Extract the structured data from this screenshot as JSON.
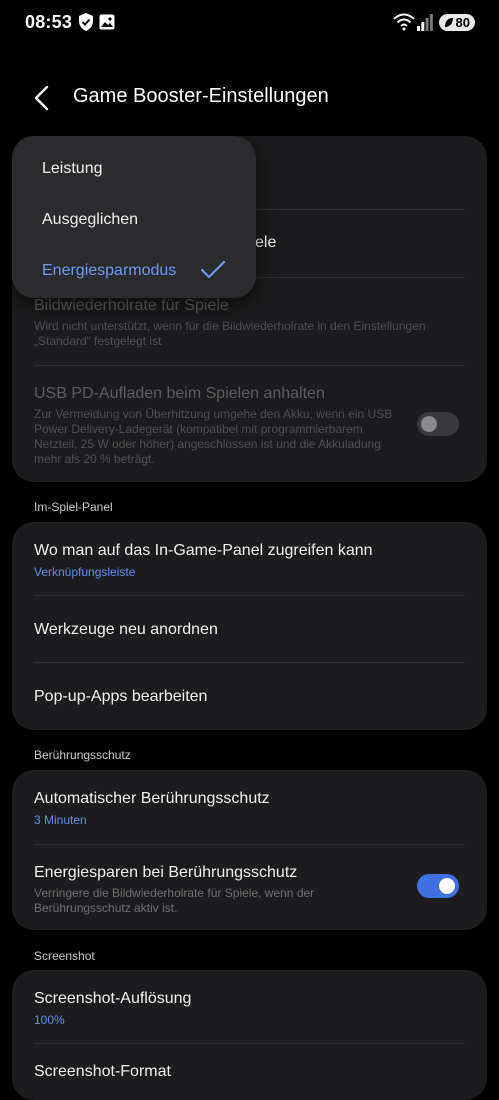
{
  "status_bar": {
    "time": "08:53",
    "battery": "80",
    "icons": [
      "shield-check-icon",
      "image-icon",
      "wifi-icon",
      "signal-icon",
      "battery-icon"
    ]
  },
  "header": {
    "title": "Game Booster-Einstellungen",
    "back_icon": "chevron-left-icon"
  },
  "performance_card": {
    "row2_fragment": "ele",
    "refresh": {
      "title": "Bildwiederholrate für Spiele",
      "desc": "Wird nicht unterstützt, wenn für die Bildwiederholrate in den Einstellungen „Standard“ festgelegt ist"
    },
    "usb_pd": {
      "title": "USB PD-Aufladen beim Spielen anhalten",
      "desc": "Zur Vermeidung von Überhitzung umgehe den Akku, wenn ein USB Power Delivery-Ladegerät (kompatibel mit programmierbarem Netzteil, 25 W oder höher) angeschlossen ist und die Akkuladung mehr als 20 % beträgt.",
      "enabled": false
    }
  },
  "dropdown": {
    "options": [
      "Leistung",
      "Ausgeglichen",
      "Energiesparmodus"
    ],
    "selected": "Energiesparmodus"
  },
  "panel_section": {
    "label": "Im-Spiel-Panel",
    "access": {
      "title": "Wo man auf das In-Game-Panel zugreifen kann",
      "value": "Verknüpfungsleiste"
    },
    "rearrange": "Werkzeuge neu anordnen",
    "popup_apps": "Pop-up-Apps bearbeiten"
  },
  "touch_section": {
    "label": "Berührungsschutz",
    "auto": {
      "title": "Automatischer Berührungsschutz",
      "value": "3 Minuten"
    },
    "power_save": {
      "title": "Energiesparen bei Berührungsschutz",
      "desc": "Verringere die Bildwiederholrate für Spiele, wenn der Berührungsschutz aktiv ist.",
      "enabled": true
    }
  },
  "screenshot_section": {
    "label": "Screenshot",
    "resolution": {
      "title": "Screenshot-Auflösung",
      "value": "100%"
    },
    "format": {
      "title": "Screenshot-Format"
    }
  },
  "colors": {
    "accent": "#3f6fe0",
    "link": "#5a8ef2",
    "card": "#1c1c1e",
    "popup": "#2b2b2e"
  }
}
